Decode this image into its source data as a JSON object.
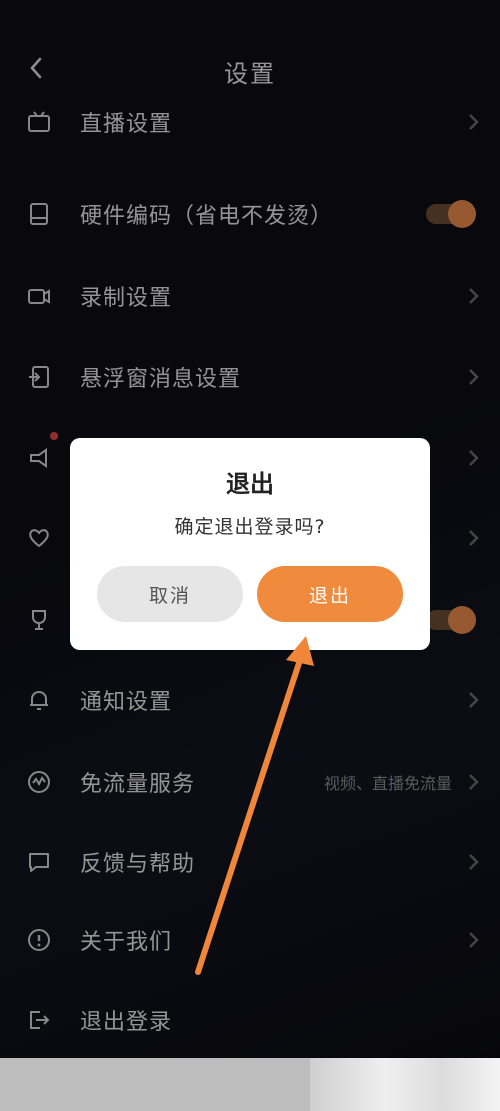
{
  "header": {
    "title": "设置"
  },
  "settings": [
    {
      "label": "直播设置",
      "type": "link"
    },
    {
      "label": "硬件编码（省电不发烫）",
      "type": "toggle",
      "on": true
    },
    {
      "label": "录制设置",
      "type": "link"
    },
    {
      "label": "悬浮窗消息设置",
      "type": "link"
    },
    {
      "label": "",
      "type": "link"
    },
    {
      "label": "",
      "type": "link"
    },
    {
      "label": "",
      "type": "toggle",
      "on": true
    },
    {
      "label": "通知设置",
      "type": "link"
    },
    {
      "label": "免流量服务",
      "type": "link",
      "sub": "视频、直播免流量"
    },
    {
      "label": "反馈与帮助",
      "type": "link"
    },
    {
      "label": "关于我们",
      "type": "link"
    },
    {
      "label": "退出登录",
      "type": "link"
    }
  ],
  "dialog": {
    "title": "退出",
    "message": "确定退出登录吗?",
    "cancel_label": "取消",
    "confirm_label": "退出"
  },
  "colors": {
    "accent": "#f08a3c",
    "toggle_knob": "#e88a4a",
    "dialog_bg": "#ffffff",
    "badge": "#e24848"
  }
}
